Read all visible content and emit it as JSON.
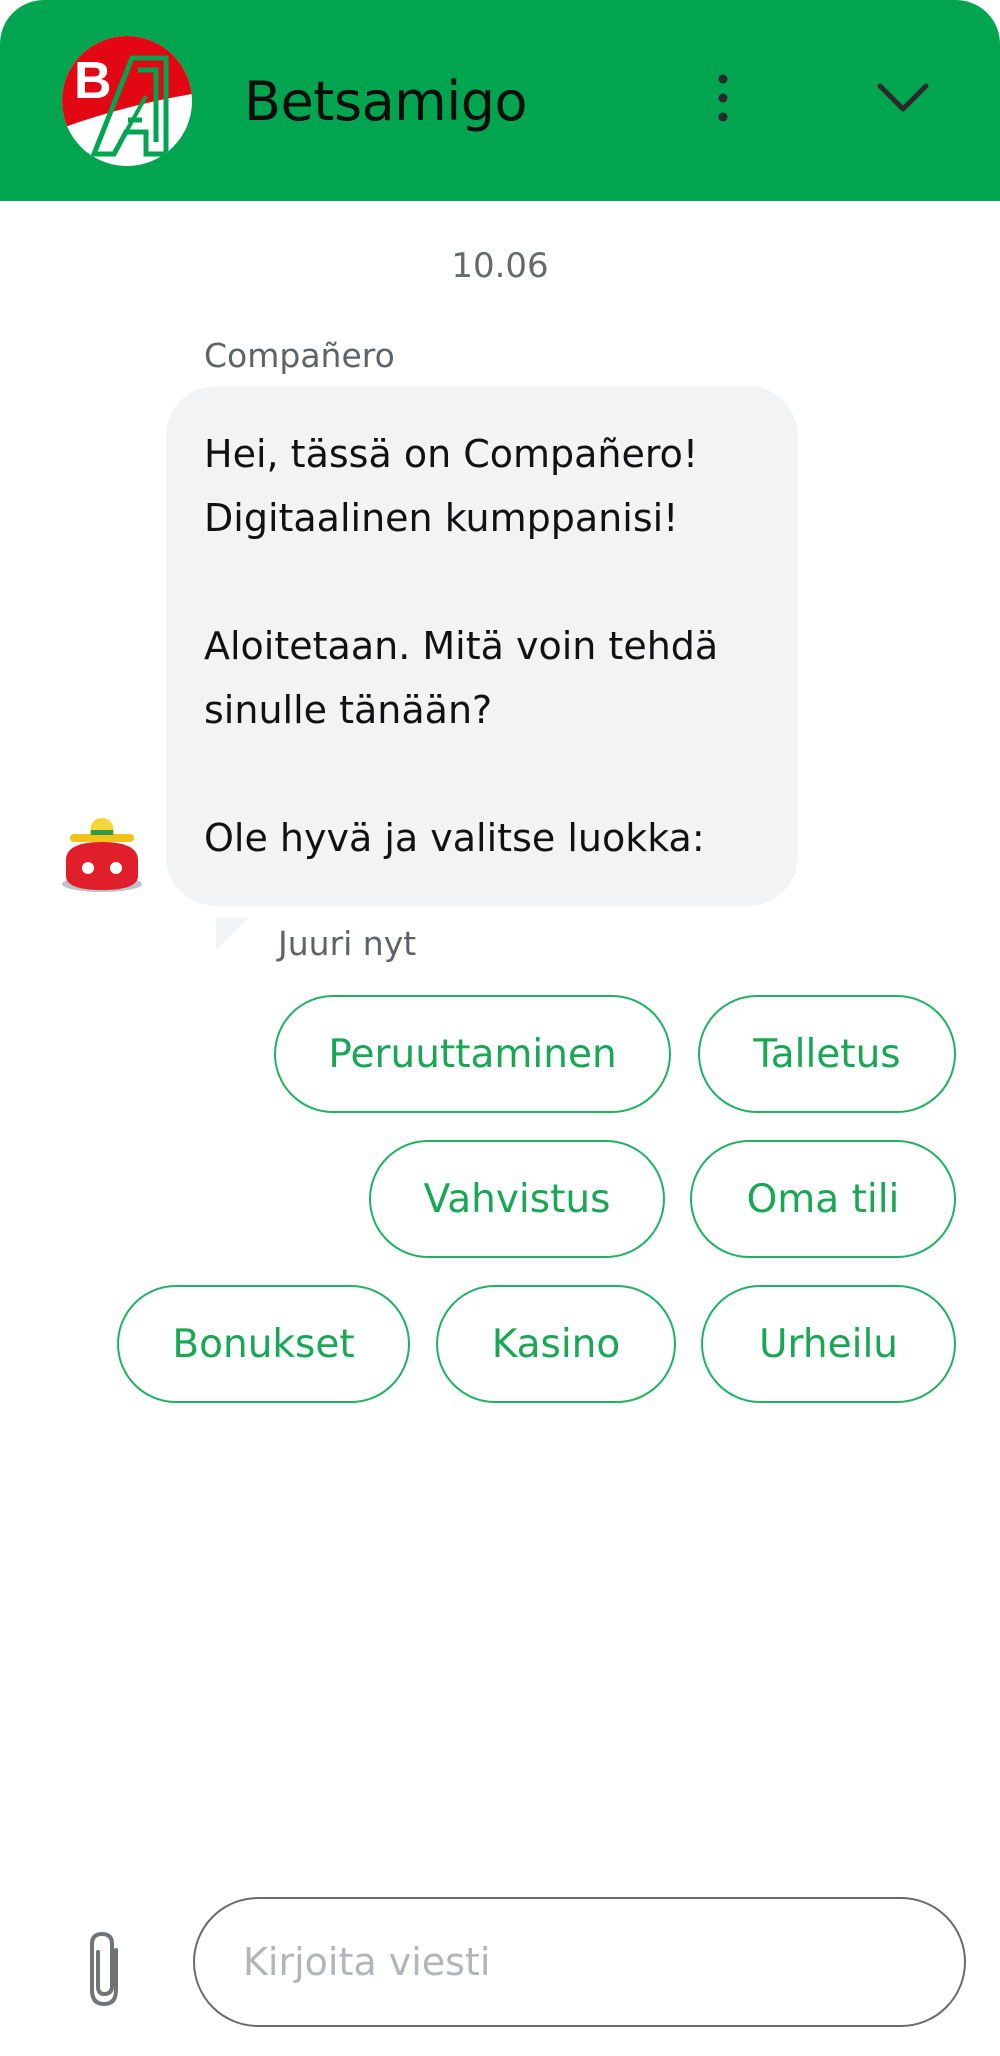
{
  "header": {
    "title": "Betsamigo",
    "logo_icon": "betsamigo-logo-icon",
    "menu_icon": "more-vertical-icon",
    "collapse_icon": "chevron-down-icon",
    "background_color": "#02a54f"
  },
  "conversation": {
    "date": "10.06",
    "sender": "Compañero",
    "avatar_icon": "bot-avatar-icon",
    "message_lines": [
      "Hei, tässä on Compañero!",
      "Digitaalinen kumppanisi!",
      "Aloitetaan. Mitä voin tehdä",
      "sinulle tänään?",
      "Ole hyvä ja valitse luokka:"
    ],
    "timestamp": "Juuri nyt"
  },
  "quick_replies": [
    {
      "label": "Peruuttaminen"
    },
    {
      "label": "Talletus"
    },
    {
      "label": "Vahvistus"
    },
    {
      "label": "Oma tili"
    },
    {
      "label": "Bonukset"
    },
    {
      "label": "Kasino"
    },
    {
      "label": "Urheilu"
    }
  ],
  "composer": {
    "placeholder": "Kirjoita viesti",
    "value": "",
    "attach_icon": "paperclip-icon"
  },
  "colors": {
    "accent": "#02a54f",
    "chip_border": "#1fb35f",
    "bubble_bg": "#f1f3f4"
  }
}
